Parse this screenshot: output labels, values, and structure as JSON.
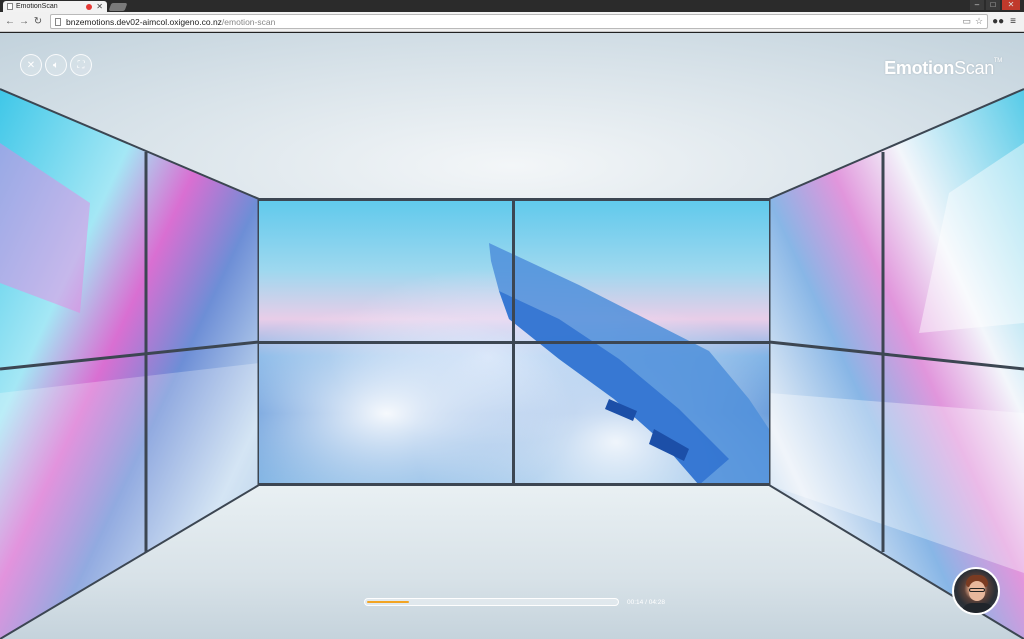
{
  "browser": {
    "tab_title": "EmotionScan",
    "url_host": "bnzemotions.dev02-aimcol.oxigeno.co.nz",
    "url_path": "/emotion-scan"
  },
  "player": {
    "logo_bold": "Em",
    "logo_bold2": "tion",
    "logo_rest": "Scan",
    "logo_tm": "TM",
    "time_current": "00:14",
    "time_total": "04:28",
    "time_separator": " / ",
    "progress_fraction": 0.17
  },
  "icons": {
    "close": "close-icon",
    "volume": "volume-icon",
    "fullscreen": "fullscreen-icon"
  }
}
